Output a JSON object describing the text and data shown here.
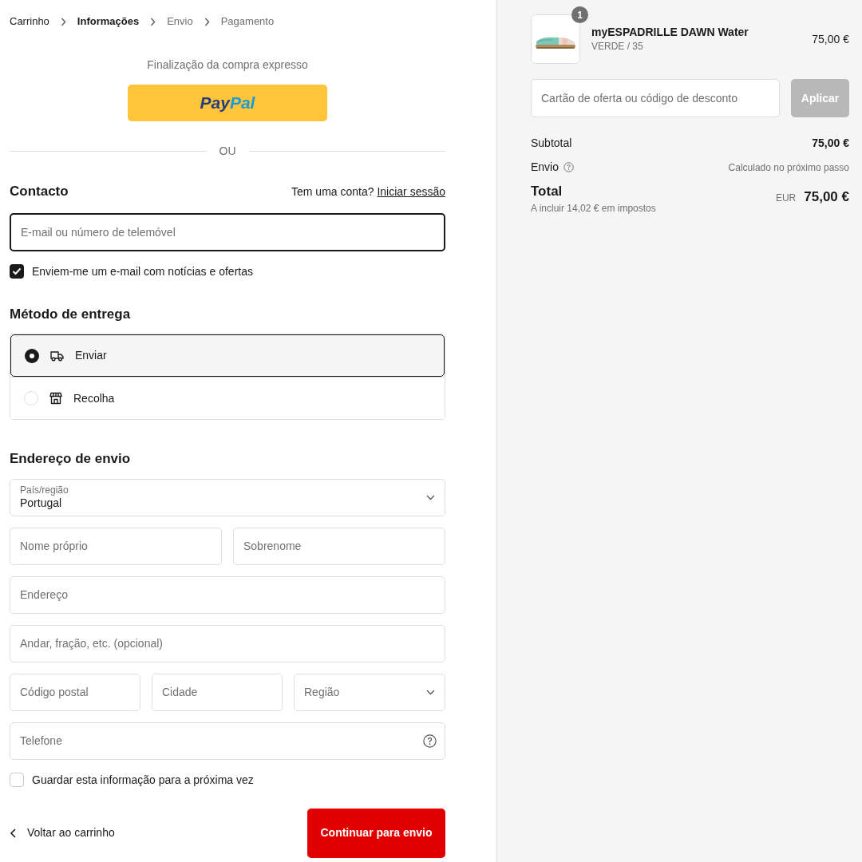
{
  "breadcrumb": [
    {
      "label": "Carrinho",
      "selected": false,
      "visited": true
    },
    {
      "label": "Informações",
      "selected": true,
      "visited": true
    },
    {
      "label": "Envio",
      "selected": false,
      "visited": false
    },
    {
      "label": "Pagamento",
      "selected": false,
      "visited": false
    }
  ],
  "express": {
    "title": "Finalização da compra expresso",
    "paypal": [
      "Pay",
      "Pal"
    ]
  },
  "divider_label": "OU",
  "contact": {
    "heading": "Contacto",
    "account_prompt": "Tem uma conta?",
    "login_link": "Iniciar sessão",
    "email": {
      "placeholder": "E-mail ou número de telemóvel",
      "focused": true
    },
    "newsletter": {
      "label": "Enviem-me um e-mail com notícias e ofertas",
      "checked": true
    }
  },
  "delivery": {
    "heading": "Método de entrega",
    "options": [
      {
        "kind": "ship",
        "label": "Enviar",
        "selected": true
      },
      {
        "kind": "pickup",
        "label": "Recolha",
        "selected": false
      }
    ]
  },
  "address": {
    "heading": "Endereço de envio",
    "rows": [
      [
        {
          "kind": "select",
          "label": "País/região",
          "value": "Portugal"
        }
      ],
      [
        {
          "kind": "text",
          "placeholder": "Nome próprio"
        },
        {
          "kind": "text",
          "placeholder": "Sobrenome"
        }
      ],
      [
        {
          "kind": "text",
          "placeholder": "Endereço"
        }
      ],
      [
        {
          "kind": "text",
          "placeholder": "Andar, fração, etc. (opcional)"
        }
      ],
      [
        {
          "kind": "text",
          "placeholder": "Código postal"
        },
        {
          "kind": "text",
          "placeholder": "Cidade"
        },
        {
          "kind": "select",
          "placeholder": "Região"
        }
      ],
      [
        {
          "kind": "help",
          "placeholder": "Telefone"
        }
      ]
    ],
    "save_info": {
      "label": "Guardar esta informação para a próxima vez",
      "checked": false
    }
  },
  "back_link": "Voltar ao carrinho",
  "continue_button": "Continuar para envio",
  "summary": {
    "item": {
      "quantity": "1",
      "name": "myESPADRILLE DAWN Water",
      "variant": "VERDE / 35",
      "price": "75,00 €"
    },
    "discount": {
      "placeholder": "Cartão de oferta ou código de desconto",
      "button": "Aplicar",
      "disabled": true
    },
    "subtotal": {
      "label": "Subtotal",
      "value": "75,00 €"
    },
    "shipping": {
      "label": "Envio",
      "value": "Calculado no próximo passo"
    },
    "total": {
      "label": "Total",
      "tax_note": "A incluir 14,02 € em impostos",
      "currency": "EUR",
      "value": "75,00 €"
    }
  }
}
